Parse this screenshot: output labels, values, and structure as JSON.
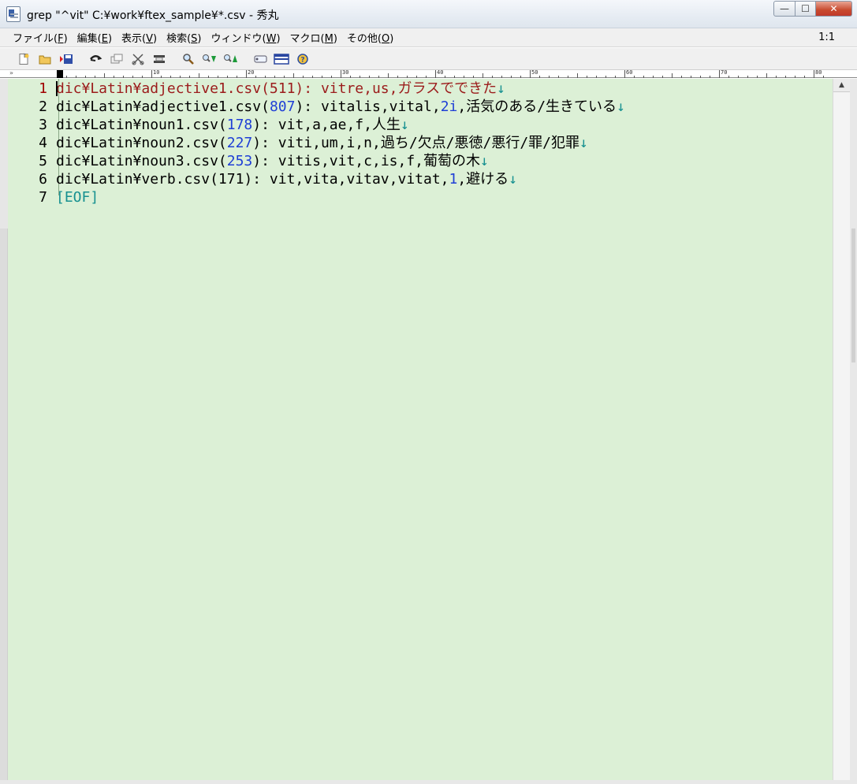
{
  "window": {
    "title": "grep \"^vit\" C:¥work¥ftex_sample¥*.csv - 秀丸",
    "icon": "document-icon",
    "buttons": {
      "minimize": "—",
      "maximize": "☐",
      "close": "✕"
    }
  },
  "menu": {
    "items": [
      {
        "label": "ファイル(",
        "key": "F",
        "end": ")"
      },
      {
        "label": "編集(",
        "key": "E",
        "end": ")"
      },
      {
        "label": "表示(",
        "key": "V",
        "end": ")"
      },
      {
        "label": "検索(",
        "key": "S",
        "end": ")"
      },
      {
        "label": "ウィンドウ(",
        "key": "W",
        "end": ")"
      },
      {
        "label": "マクロ(",
        "key": "M",
        "end": ")"
      },
      {
        "label": "その他(",
        "key": "O",
        "end": ")"
      }
    ],
    "cursor_position": "1:1"
  },
  "toolbar": {
    "icons": [
      "new-file-icon",
      "open-folder-icon",
      "save-icon",
      "undo-icon",
      "copy-icon",
      "cut-icon",
      "paste-icon",
      "find-icon",
      "find-next-icon",
      "find-prev-icon",
      "tag-jump-icon",
      "split-window-icon",
      "help-icon"
    ]
  },
  "ruler": {
    "labels": [
      "0",
      "10",
      "20",
      "30",
      "40",
      "50",
      "60",
      "70",
      "80"
    ]
  },
  "editor": {
    "lines": [
      {
        "num": "1",
        "segments": [
          {
            "text": "dic¥Latin¥adjective1.csv(511): vitre,us,ガラスでできた",
            "color": "red"
          },
          {
            "text": "↓",
            "color": "teal"
          }
        ]
      },
      {
        "num": "2",
        "segments": [
          {
            "text": "dic¥Latin¥adjective1.csv(",
            "color": "black"
          },
          {
            "text": "807",
            "color": "blue"
          },
          {
            "text": "): vitalis,vital,",
            "color": "black"
          },
          {
            "text": "2i",
            "color": "blue"
          },
          {
            "text": ",活気のある/生きている",
            "color": "black"
          },
          {
            "text": "↓",
            "color": "teal"
          }
        ]
      },
      {
        "num": "3",
        "segments": [
          {
            "text": "dic¥Latin¥noun1.csv(",
            "color": "black"
          },
          {
            "text": "178",
            "color": "blue"
          },
          {
            "text": "): vit,a,ae,f,人生",
            "color": "black"
          },
          {
            "text": "↓",
            "color": "teal"
          }
        ]
      },
      {
        "num": "4",
        "segments": [
          {
            "text": "dic¥Latin¥noun2.csv(",
            "color": "black"
          },
          {
            "text": "227",
            "color": "blue"
          },
          {
            "text": "): viti,um,i,n,過ち/欠点/悪徳/悪行/罪/犯罪",
            "color": "black"
          },
          {
            "text": "↓",
            "color": "teal"
          }
        ]
      },
      {
        "num": "5",
        "segments": [
          {
            "text": "dic¥Latin¥noun3.csv(",
            "color": "black"
          },
          {
            "text": "253",
            "color": "blue"
          },
          {
            "text": "): vitis,vit,c,is,f,葡萄の木",
            "color": "black"
          },
          {
            "text": "↓",
            "color": "teal"
          }
        ]
      },
      {
        "num": "6",
        "segments": [
          {
            "text": "dic¥Latin¥verb.csv(171): vit,vita,vitav,vitat,",
            "color": "black"
          },
          {
            "text": "1",
            "color": "blue"
          },
          {
            "text": ",避ける",
            "color": "black"
          },
          {
            "text": "↓",
            "color": "teal"
          }
        ]
      },
      {
        "num": "7",
        "segments": [
          {
            "text": "[EOF]",
            "color": "teal"
          }
        ]
      }
    ],
    "background_color": "#dcf0d6"
  }
}
